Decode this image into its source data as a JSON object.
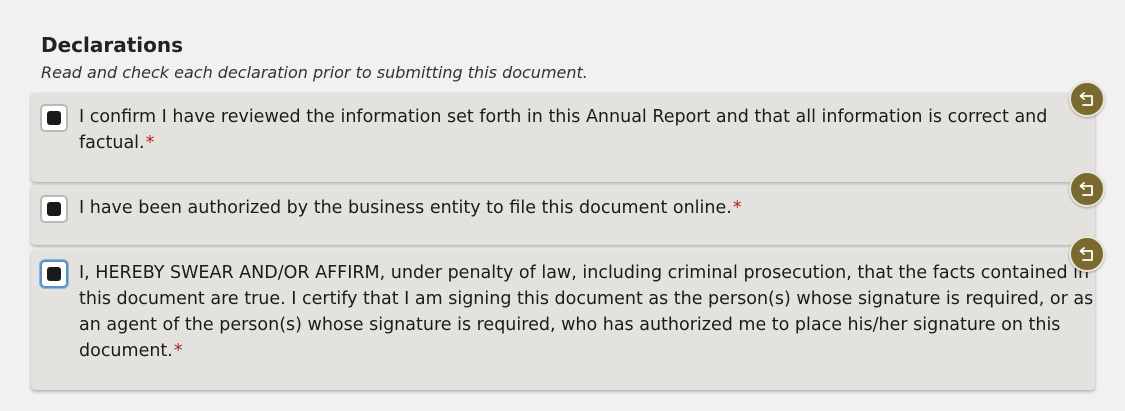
{
  "declarations": {
    "title": "Declarations",
    "subtitle": "Read and check each declaration prior to submitting this document.",
    "required_marker": "*",
    "items": [
      {
        "text": "I confirm I have reviewed the information set forth in this Annual Report and that all information is correct and factual."
      },
      {
        "text": "I have been authorized by the business entity to file this document online."
      },
      {
        "text": "I, HEREBY SWEAR AND/OR AFFIRM, under penalty of law, including criminal prosecution, that the facts contained in this document are true. I certify that I am signing this document as the person(s) whose signature is required, or as an agent of the person(s) whose signature is required, who has authorized me to place his/her signature on this document."
      }
    ]
  },
  "colors": {
    "card_background": "#e4e2de",
    "reset_button": "#7a6a2f",
    "required_marker": "#b22222",
    "focus_ring": "#5b93c7"
  },
  "icons": {
    "reset": "reset-icon"
  }
}
